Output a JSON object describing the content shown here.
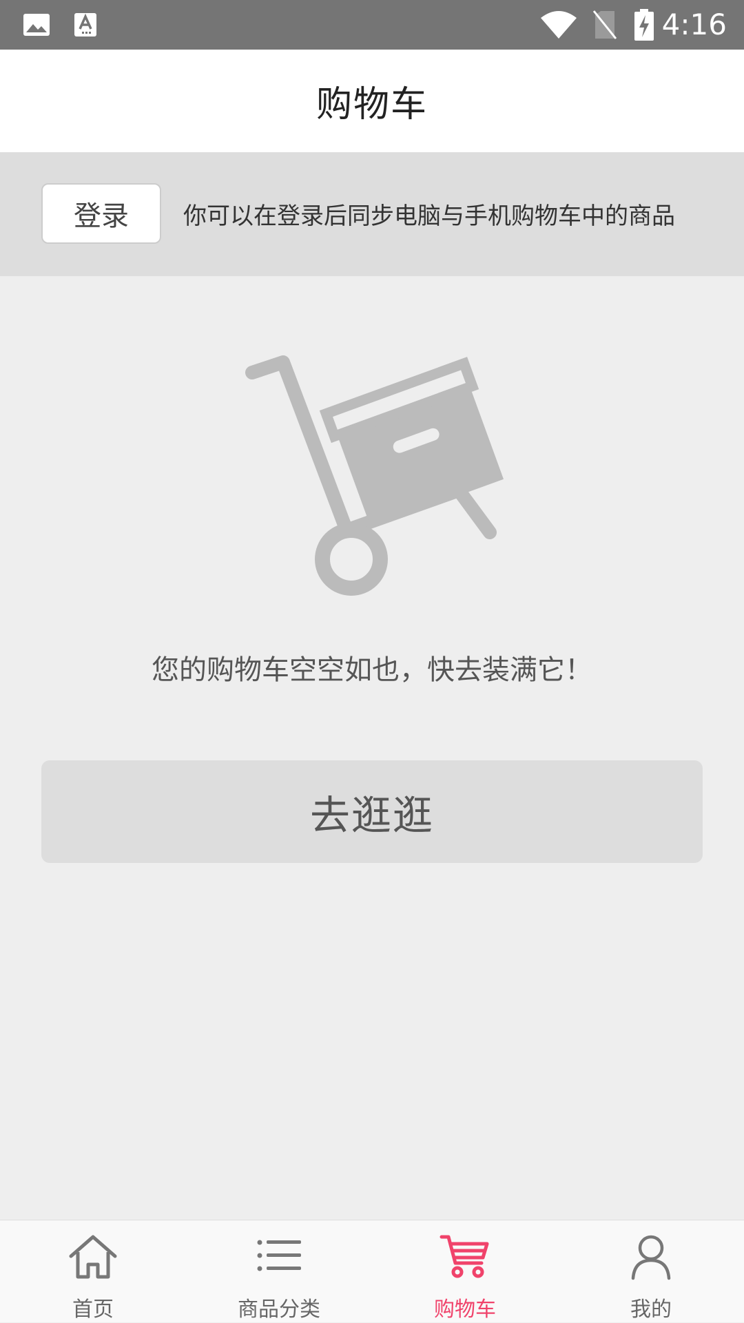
{
  "status_bar": {
    "time": "4:16",
    "left_icons": [
      "image-icon",
      "text-a-icon"
    ],
    "right_icons": [
      "wifi-icon",
      "no-sim-icon",
      "battery-charging-icon"
    ]
  },
  "header": {
    "title": "购物车"
  },
  "login_banner": {
    "button_label": "登录",
    "hint": "你可以在登录后同步电脑与手机购物车中的商品"
  },
  "empty_state": {
    "illustration_icon": "cart-trolley-box-icon",
    "message": "您的购物车空空如也，快去装满它！",
    "button_label": "去逛逛"
  },
  "tab_bar": {
    "active_color": "#f0436b",
    "inactive_color": "#666666",
    "items": [
      {
        "label": "首页",
        "icon": "home-icon",
        "active": false
      },
      {
        "label": "商品分类",
        "icon": "list-icon",
        "active": false
      },
      {
        "label": "购物车",
        "icon": "cart-icon",
        "active": true
      },
      {
        "label": "我的",
        "icon": "user-icon",
        "active": false
      }
    ]
  }
}
